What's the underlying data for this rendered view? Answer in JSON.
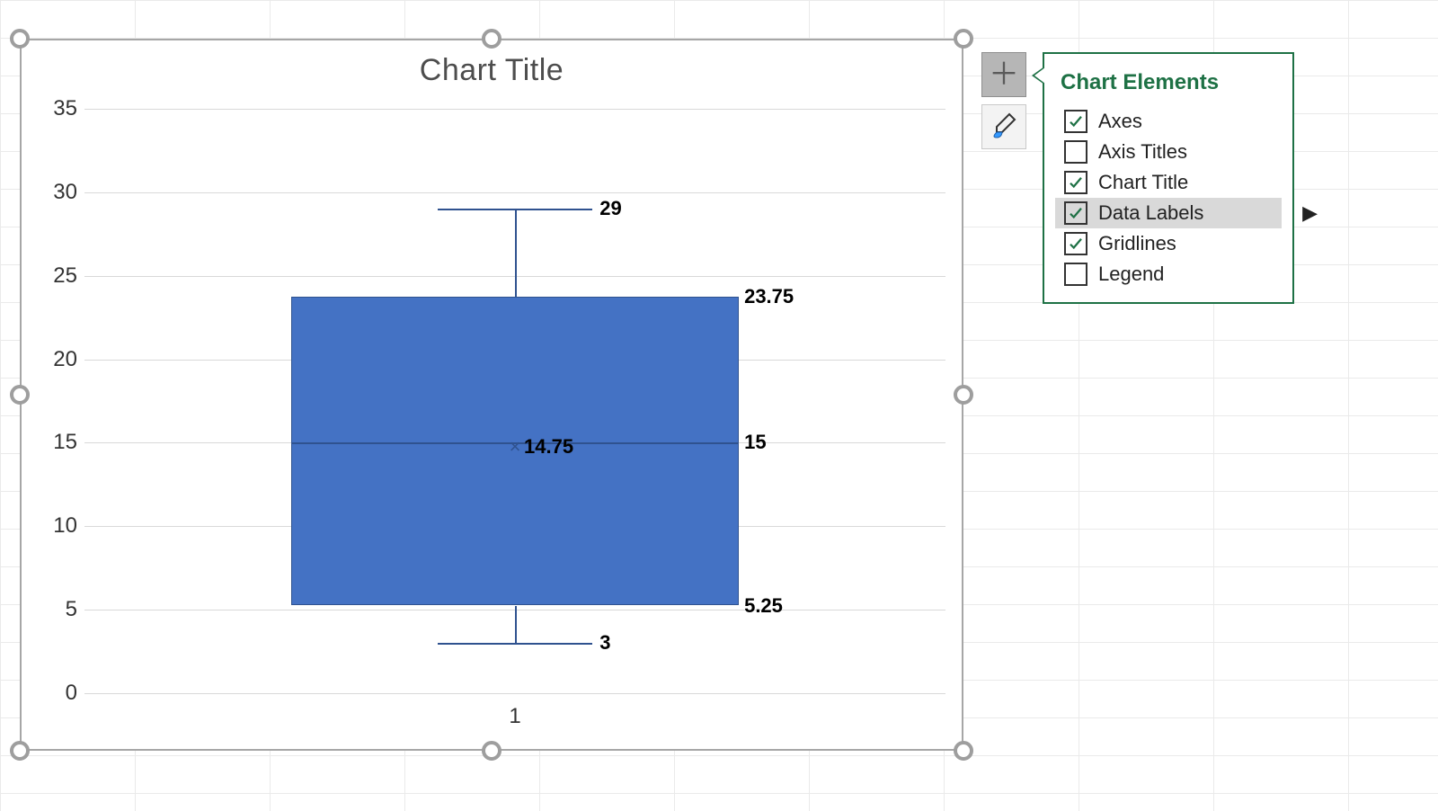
{
  "chart_data": {
    "type": "boxplot",
    "title": "Chart Title",
    "categories": [
      "1"
    ],
    "ylim": [
      0,
      35
    ],
    "ystep": 5,
    "series": [
      {
        "category": "1",
        "min": 3,
        "q1": 5.25,
        "median": 15,
        "mean": 14.75,
        "q3": 23.75,
        "max": 29
      }
    ]
  },
  "elements_panel": {
    "title": "Chart Elements",
    "items": [
      {
        "label": "Axes",
        "checked": true,
        "highlighted": false,
        "submenu": false
      },
      {
        "label": "Axis Titles",
        "checked": false,
        "highlighted": false,
        "submenu": false
      },
      {
        "label": "Chart Title",
        "checked": true,
        "highlighted": false,
        "submenu": false
      },
      {
        "label": "Data Labels",
        "checked": true,
        "highlighted": true,
        "submenu": true
      },
      {
        "label": "Gridlines",
        "checked": true,
        "highlighted": false,
        "submenu": false
      },
      {
        "label": "Legend",
        "checked": false,
        "highlighted": false,
        "submenu": false
      }
    ]
  },
  "side_buttons": {
    "plus_active": true
  },
  "colors": {
    "box_fill": "#4472c4",
    "box_line": "#2f528f",
    "accent_green": "#1e7145"
  }
}
